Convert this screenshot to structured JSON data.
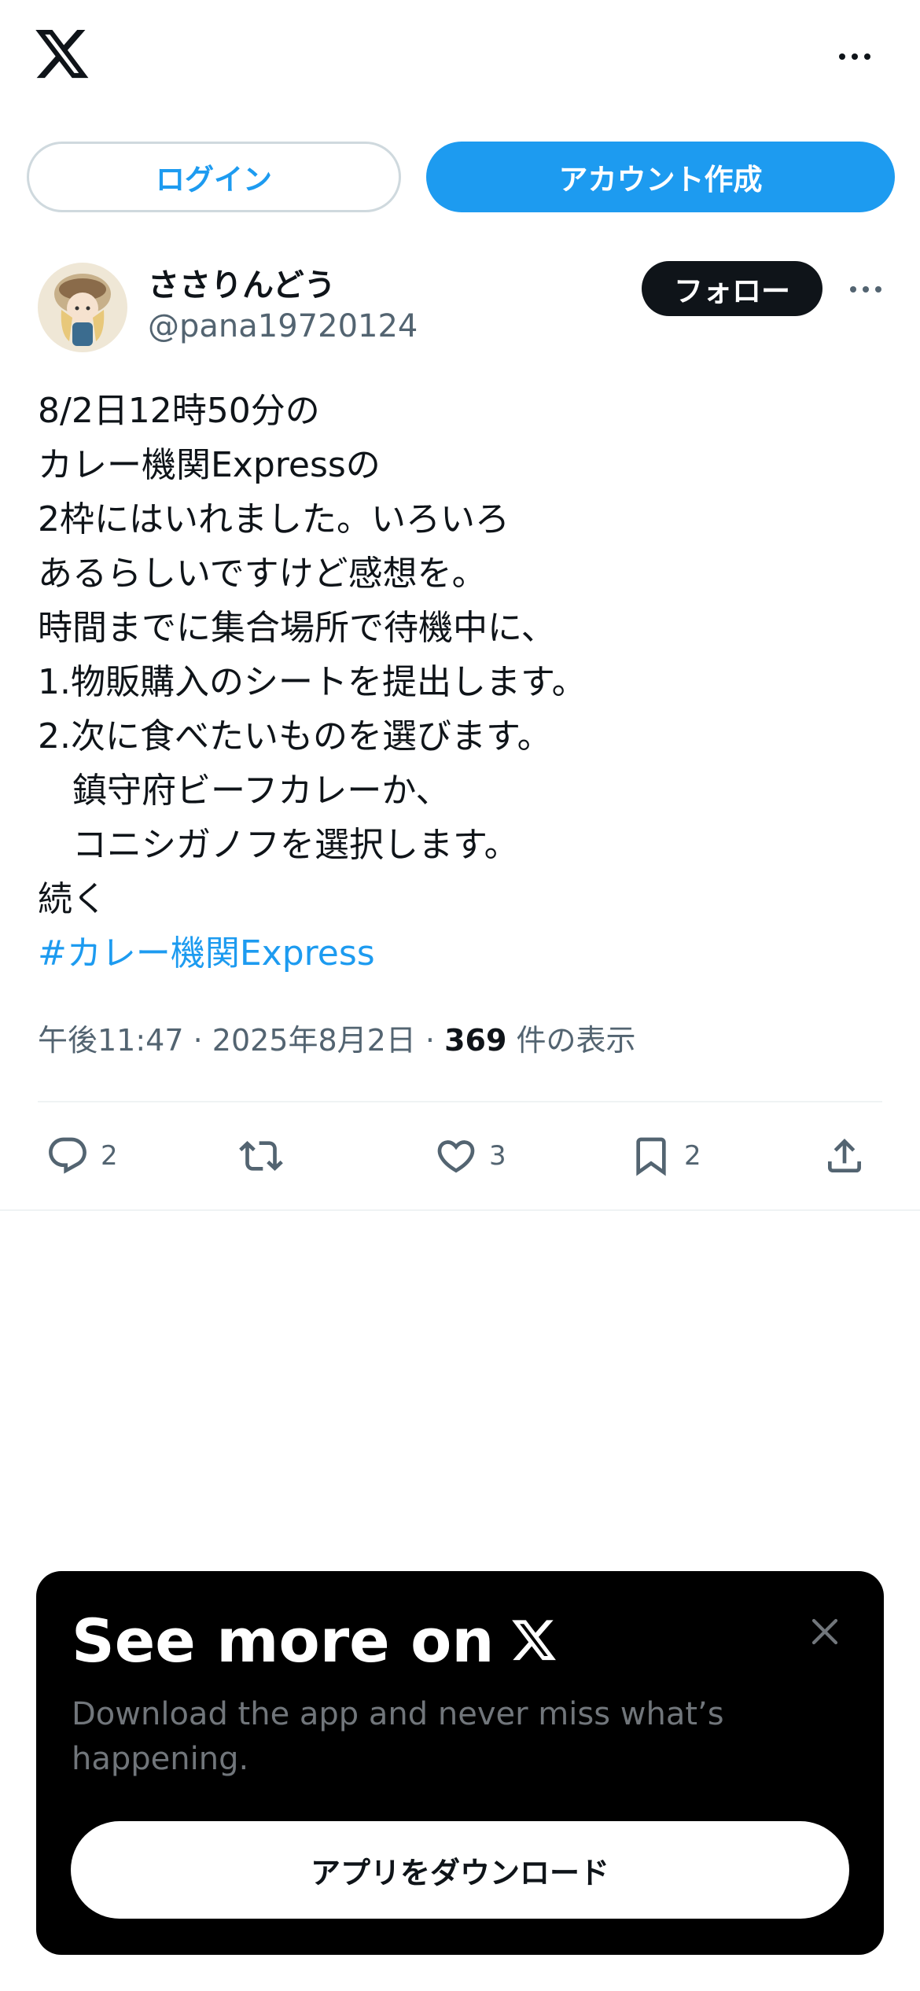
{
  "topbar": {
    "logo_icon": "x-logo-icon",
    "more_icon": "more-horizontal-icon"
  },
  "auth": {
    "login_label": "ログイン",
    "signup_label": "アカウント作成"
  },
  "post": {
    "author": {
      "display_name": "ささりんどう",
      "handle": "@pana19720124",
      "avatar_icon": "avatar-image"
    },
    "follow_label": "フォロー",
    "more_icon": "more-horizontal-icon",
    "lines": [
      "8/2日12時50分の",
      "カレー機関Expressの",
      "2枠にはいれました。いろいろ",
      "あるらしいですけど感想を。",
      "時間までに集合場所で待機中に、",
      "1.物販購入のシートを提出します。",
      "2.次に食べたいものを選びます。",
      "　鎮守府ビーフカレーか、",
      "　コニシガノフを選択します。",
      "続く"
    ],
    "hashtag": "#カレー機関Express",
    "meta": {
      "time": "午後11:47",
      "sep1": " · ",
      "date": "2025年8月2日",
      "sep2": " · ",
      "views_count": "369",
      "views_label": " 件の表示"
    },
    "actions": {
      "reply": {
        "icon": "reply-icon",
        "count": "2"
      },
      "repost": {
        "icon": "repost-icon"
      },
      "like": {
        "icon": "heart-icon",
        "count": "3"
      },
      "bookmark": {
        "icon": "bookmark-icon",
        "count": "2"
      },
      "share": {
        "icon": "share-icon"
      }
    }
  },
  "promo": {
    "title": "See more on",
    "description": "Download the app and never miss what’s happening.",
    "download_label": "アプリをダウンロード",
    "close_icon": "close-icon"
  },
  "colors": {
    "accent": "#1d9bf0",
    "text": "#0f1419",
    "secondary": "#536471",
    "border": "#cfd9de",
    "promo_bg": "#000000"
  }
}
